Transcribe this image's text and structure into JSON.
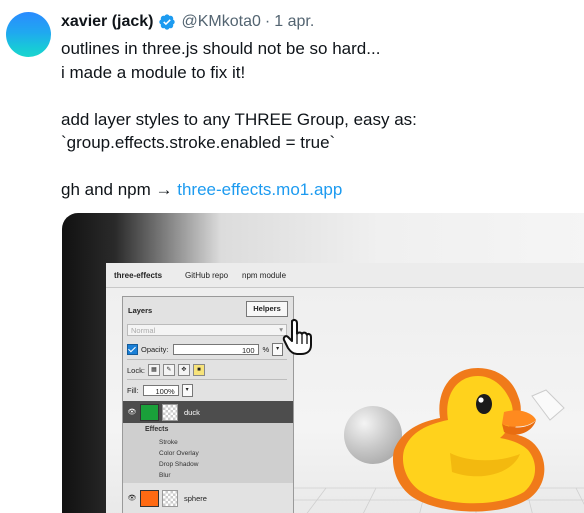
{
  "tweet": {
    "author_name": "xavier (jack)",
    "handle": "@KMkota0",
    "separator": "·",
    "date": "1 apr.",
    "lines": [
      "outlines in three.js should not be so hard...",
      "i made a module to fix it!",
      "",
      "add layer styles to any THREE Group, easy as:",
      "`group.effects.stroke.enabled = true`",
      "",
      "gh and npm →"
    ],
    "link_text": "three-effects.mo1.app"
  },
  "colors": {
    "link": "#1d9bf0",
    "verified": "#1d9bf0",
    "duck_layer": "#1aa03a",
    "sphere_layer": "#ff6a13"
  },
  "app": {
    "menu": [
      "three-effects",
      "GitHub repo",
      "npm module"
    ],
    "panel": {
      "title": "Layers",
      "helpers_label": "Helpers",
      "blend_mode": "Normal",
      "opacity_label": "Opacity:",
      "opacity_value": "100",
      "opacity_unit": "%",
      "lock_label": "Lock:",
      "fill_label": "Fill:",
      "fill_value": "100%",
      "layers": [
        {
          "name": "duck",
          "selected": true
        },
        {
          "name": "sphere",
          "selected": false
        }
      ],
      "effects_title": "Effects",
      "effects": [
        "Stroke",
        "Color Overlay",
        "Drop Shadow",
        "Blur"
      ]
    }
  }
}
